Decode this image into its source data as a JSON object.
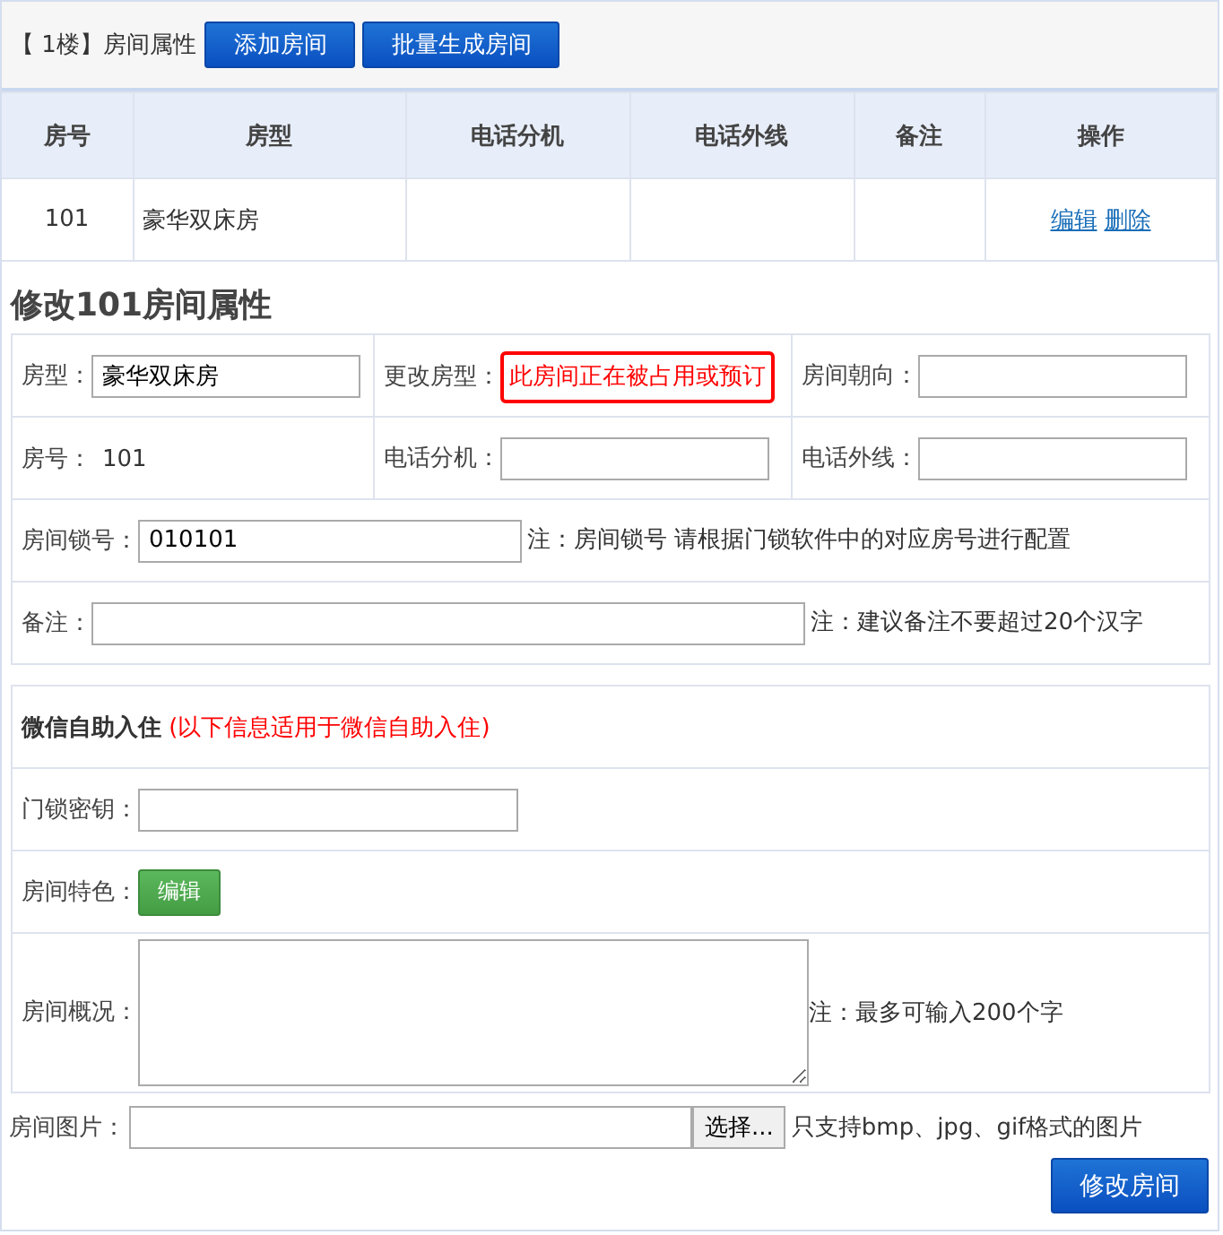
{
  "toolbar": {
    "floor_label": "【 1楼】房间属性",
    "buttons": [
      "添加房间",
      "批量生成房间"
    ]
  },
  "table": {
    "columns": [
      "房号",
      "房型",
      "电话分机",
      "电话外线",
      "备注",
      "操作"
    ],
    "rows": [
      {
        "room_no": "101",
        "room_type": "豪华双床房",
        "actions": [
          "编辑",
          "删除"
        ]
      }
    ]
  },
  "form": {
    "title": "修改101房间属性",
    "room_type": {
      "label": "房型：",
      "value": "豪华双床房"
    },
    "change_type": {
      "label": "更改房型：",
      "warning": "此房间正在被占用或预订"
    },
    "orientation": {
      "label": "房间朝向："
    },
    "room_no": {
      "label": "房号：",
      "value": "101"
    },
    "extension": {
      "label": "电话分机："
    },
    "outside_line": {
      "label": "电话外线："
    },
    "lock_no": {
      "label": "房间锁号：",
      "value": "010101",
      "note": "注：房间锁号 请根据门锁软件中的对应房号进行配置"
    },
    "remark": {
      "label": "备注：",
      "note": "注：建议备注不要超过20个汉字"
    }
  },
  "wechat": {
    "heading": "微信自助入住",
    "subheading": "(以下信息适用于微信自助入住)",
    "lock_key": {
      "label": "门锁密钥："
    },
    "features": {
      "label": "房间特色：",
      "button": "编辑"
    },
    "overview": {
      "label": "房间概况：",
      "note": "注：最多可输入200个字"
    }
  },
  "photo": {
    "label": "房间图片：",
    "button": "选择...",
    "note": "只支持bmp、jpg、gif格式的图片"
  },
  "submit": "修改房间"
}
